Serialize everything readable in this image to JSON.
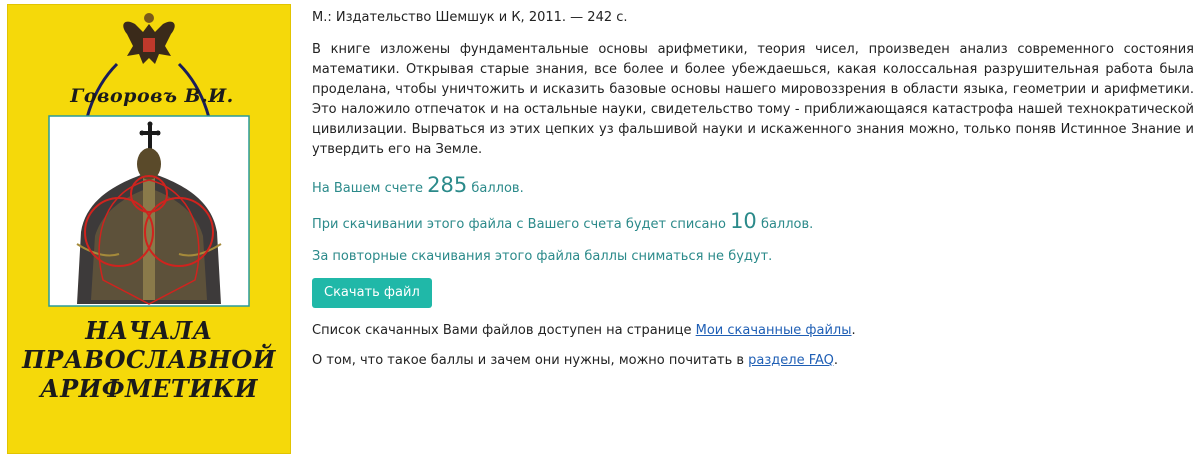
{
  "book": {
    "cover_author": "Говоровъ В.И.",
    "cover_title_line1": "НАЧАЛА",
    "cover_title_line2": "ПРАВОСЛАВНОЙ",
    "cover_title_line3": "АРИФМЕТИКИ",
    "meta": "М.: Издательство Шемшук и К, 2011. — 242 с.",
    "description": "В книге изложены фундаментальные основы арифметики, теория чисел, произведен анализ современного состояния математики. Открывая старые знания, все более и более убеждаешься, какая колоссальная разрушительная работа была проделана, чтобы уничтожить и исказить базовые основы нашего мировоззрения в области языка, геометрии и арифметики. Это наложило отпечаток и на остальные науки, свидетельство тому - приближающаяся катастрофа нашей технократической цивилизации. Вырваться из этих цепких уз фальшивой науки и искаженного знания можно, только поняв Истинное Знание и утвердить его на Земле."
  },
  "balance": {
    "prefix": "На Вашем счете",
    "value": "285",
    "suffix": "баллов."
  },
  "cost": {
    "prefix": "При скачивании этого файла с Вашего счета будет списано",
    "value": "10",
    "suffix": "баллов."
  },
  "repeat_note": "За повторные скачивания этого файла баллы сниматься не будут.",
  "download_button": "Скачать файл",
  "downloads_note": {
    "text": "Список скачанных Вами файлов доступен на странице",
    "link": "Мои скачанные файлы",
    "end": "."
  },
  "faq_note": {
    "text": "О том, что такое баллы и зачем они нужны, можно почитать в",
    "link": "разделе FAQ",
    "end": "."
  },
  "colors": {
    "cover_yellow": "#f5d90a",
    "teal_text": "#2b8a8a",
    "button": "#20b8a8",
    "link": "#1f5fb5"
  }
}
